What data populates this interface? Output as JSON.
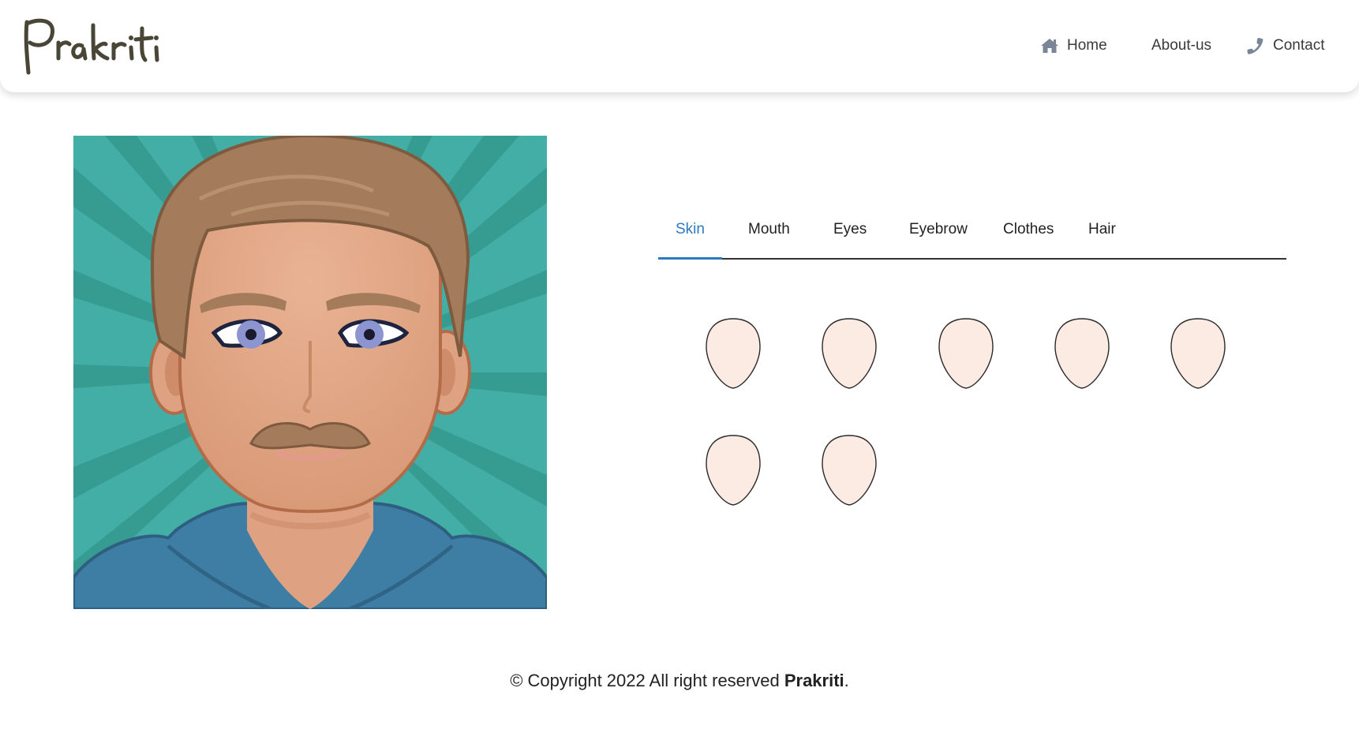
{
  "brand": {
    "name": "Prakriti",
    "logo_icon": "handwritten-script-logo"
  },
  "nav": {
    "home": {
      "label": "Home",
      "icon": "home-icon"
    },
    "about": {
      "label": "About-us"
    },
    "contact": {
      "label": "Contact",
      "icon": "phone-icon"
    }
  },
  "tabs": {
    "active": "Skin",
    "items": [
      {
        "label": "Skin"
      },
      {
        "label": "Mouth"
      },
      {
        "label": "Eyes"
      },
      {
        "label": "Eyebrow"
      },
      {
        "label": "Clothes"
      },
      {
        "label": "Hair"
      }
    ]
  },
  "skin_options": {
    "count": 7,
    "fill_color": "#fcebe2",
    "stroke_color": "#2a2a2a"
  },
  "footer": {
    "prefix": "© Copyright 2022 All right reserved ",
    "brand": "Prakriti",
    "suffix": "."
  },
  "colors": {
    "accent": "#2d7ac0",
    "avatar_background": "#43aea6",
    "avatar_skin": "#dea282",
    "avatar_hair": "#a47c5b",
    "avatar_shirt": "#3f7ea4"
  }
}
